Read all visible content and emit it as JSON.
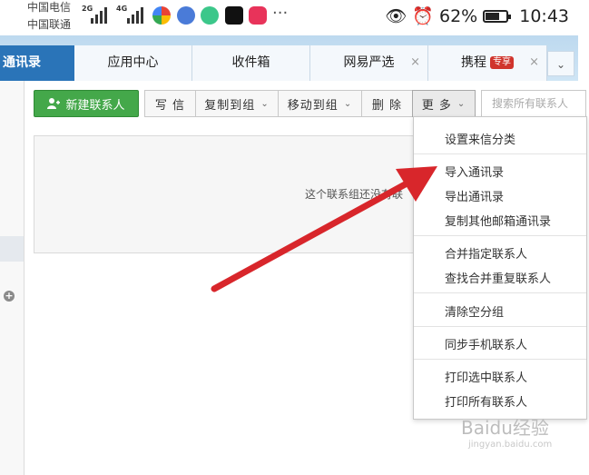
{
  "status_bar": {
    "carrier1": "中国电信",
    "carrier2": "中国联通",
    "net1": "2G",
    "net2": "4G",
    "more": "···",
    "battery": "62%",
    "time": "10:43"
  },
  "tabs": {
    "active": "通讯录",
    "items": [
      "应用中心",
      "收件箱",
      "网易严选",
      "携程"
    ],
    "badge": "专享",
    "close": "×",
    "overflow": "⌄"
  },
  "toolbar": {
    "new_contact": "新建联系人",
    "write": "写 信",
    "copy_to_group": "复制到组",
    "move_to_group": "移动到组",
    "delete": "删 除",
    "more": "更 多",
    "search_placeholder": "搜索所有联系人"
  },
  "content": {
    "empty_message": "这个联系组还没有联"
  },
  "more_menu": {
    "items": [
      "设置来信分类",
      "导入通讯录",
      "导出通讯录",
      "复制其他邮箱通讯录",
      "合并指定联系人",
      "查找合并重复联系人",
      "清除空分组",
      "同步手机联系人",
      "打印选中联系人",
      "打印所有联系人"
    ]
  },
  "watermark": {
    "text": "Baidu经验",
    "url": "jingyan.baidu.com"
  },
  "colors": {
    "accent_blue": "#2a74b8",
    "green_button": "#44a84a",
    "arrow_red": "#d8262b"
  }
}
